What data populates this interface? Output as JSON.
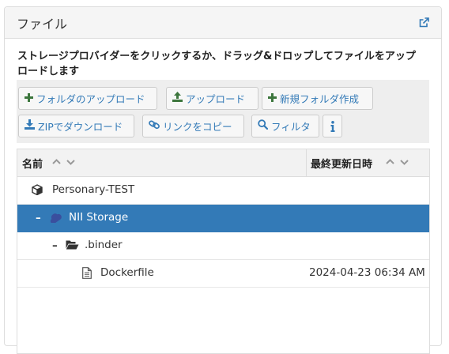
{
  "panel": {
    "title": "ファイル",
    "external_link_icon": "external-link-icon"
  },
  "instructions": "ストレージプロバイダーをクリックするか、ドラッグ&ドロップしてファイルをアップロードします",
  "toolbar": {
    "upload_folder": "フォルダのアップロード",
    "upload": "アップロード",
    "new_folder": "新規フォルダ作成",
    "zip_download": "ZIPでダウンロード",
    "copy_link": "リンクをコピー",
    "filter": "フィルタ",
    "info_icon": "info-icon"
  },
  "grid": {
    "columns": {
      "name": "名前",
      "modified": "最終更新日時"
    },
    "rows": [
      {
        "label": "Personary-TEST",
        "toggle": "",
        "icon": "cube-icon",
        "date": ""
      },
      {
        "label": "NII Storage",
        "toggle": "–",
        "icon": "cloud-icon",
        "date": "",
        "selected": true
      },
      {
        "label": ".binder",
        "toggle": "–",
        "icon": "folder-open-icon",
        "date": ""
      },
      {
        "label": "Dockerfile",
        "toggle": "",
        "icon": "file-icon",
        "date": "2024-04-23 06:34 AM"
      }
    ]
  },
  "colors": {
    "accent": "#337ab7",
    "selected_row": "#337ab7",
    "toolbar_bg": "#eeeeee",
    "add_icon": "#3c763d"
  }
}
